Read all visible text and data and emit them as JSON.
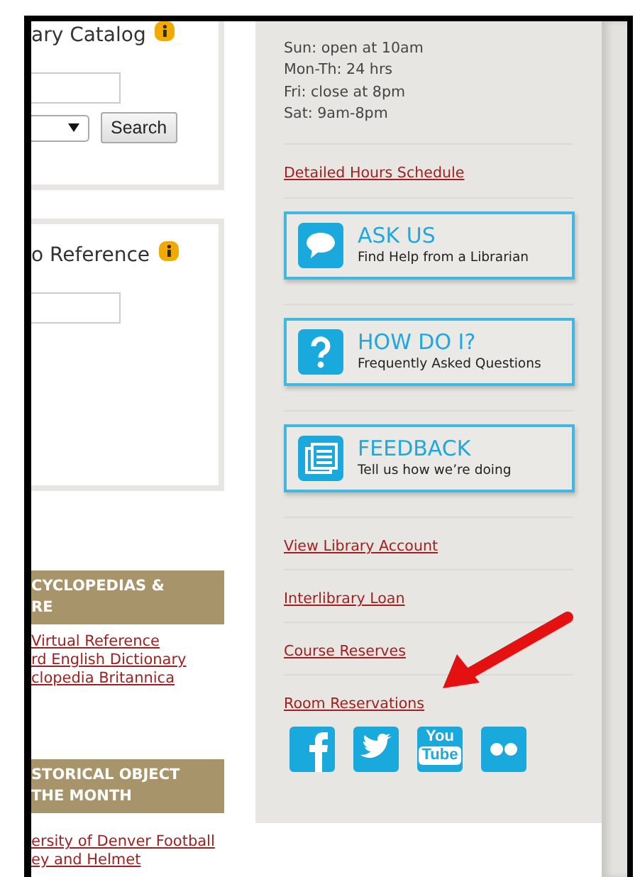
{
  "catalog_panel": {
    "heading": "ary Catalog",
    "search_button": "Search"
  },
  "reference_panel": {
    "heading": "o Reference"
  },
  "sections": [
    {
      "heading_lines": [
        "CYCLOPEDIAS &",
        "RE"
      ],
      "links": [
        "Virtual Reference",
        "rd English Dictionary",
        "clopedia Britannica"
      ]
    },
    {
      "heading_lines": [
        "STORICAL OBJECT",
        "THE MONTH"
      ],
      "links": [
        "ersity of Denver Football",
        "ey and Helmet"
      ]
    }
  ],
  "sidebar": {
    "hours": [
      "Sun: open at 10am",
      "Mon-Th: 24 hrs",
      "Fri: close at 8pm",
      "Sat: 9am-8pm"
    ],
    "hours_link": "Detailed Hours Schedule",
    "service_buttons": [
      {
        "kind": "chat",
        "title": "ASK US",
        "subtitle": "Find Help from a Librarian"
      },
      {
        "kind": "question",
        "title": "HOW DO I?",
        "subtitle": "Frequently Asked Questions"
      },
      {
        "kind": "feedback",
        "title": "FEEDBACK",
        "subtitle": "Tell us how we’re doing"
      }
    ],
    "links": [
      "View Library Account",
      "Interlibrary Loan",
      "Course Reserves",
      "Room Reservations"
    ],
    "social": [
      {
        "kind": "facebook"
      },
      {
        "kind": "twitter"
      },
      {
        "kind": "youtube",
        "lines": [
          "You",
          "Tube"
        ]
      },
      {
        "kind": "flickr"
      }
    ]
  }
}
